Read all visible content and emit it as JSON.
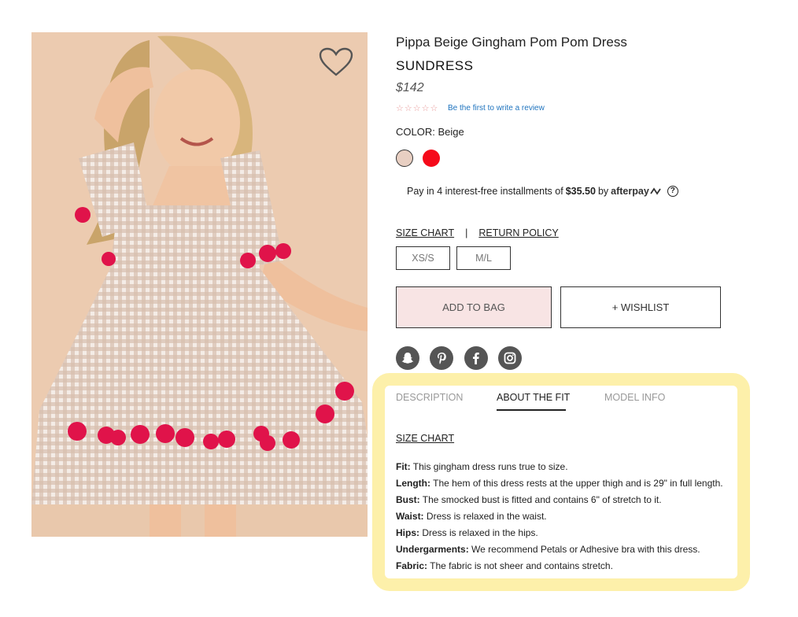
{
  "product": {
    "title": "Pippa Beige Gingham Pom Pom Dress",
    "subtitle": "SUNDRESS",
    "price": "$142",
    "stars": "☆☆☆☆☆",
    "review_link": "Be the first to write a review",
    "color_label": "COLOR: Beige",
    "swatches": [
      {
        "name": "Beige",
        "color": "#e8cfc2",
        "selected": true
      },
      {
        "name": "Red",
        "color": "#f50a1a",
        "selected": false
      }
    ]
  },
  "afterpay": {
    "prefix": "Pay in 4 interest-free installments of",
    "amount": "$35.50",
    "by": "by",
    "brand": "afterpay",
    "help": "?"
  },
  "links": {
    "size_chart": "SIZE CHART",
    "separator": "|",
    "return_policy": "RETURN POLICY"
  },
  "sizes": [
    "XS/S",
    "M/L"
  ],
  "buttons": {
    "add_to_bag": "ADD TO BAG",
    "wishlist": "+ WISHLIST"
  },
  "social_icons": [
    "snapchat-icon",
    "pinterest-icon",
    "facebook-icon",
    "instagram-icon"
  ],
  "tabs": [
    {
      "label": "DESCRIPTION",
      "active": false
    },
    {
      "label": "ABOUT THE FIT",
      "active": true
    },
    {
      "label": "MODEL INFO",
      "active": false
    }
  ],
  "fit": {
    "size_chart_link": "SIZE CHART",
    "details": [
      {
        "label": "Fit:",
        "text": "This gingham dress runs true to size."
      },
      {
        "label": "Length:",
        "text": "The hem of this dress rests at the upper thigh and is 29\" in full length."
      },
      {
        "label": "Bust:",
        "text": "The smocked bust is fitted and contains 6\" of stretch to it."
      },
      {
        "label": "Waist:",
        "text": "Dress is relaxed in the waist."
      },
      {
        "label": "Hips:",
        "text": "Dress is relaxed in the hips."
      },
      {
        "label": "Undergarments:",
        "text": "We recommend Petals or Adhesive bra with this dress."
      },
      {
        "label": "Fabric:",
        "text": "The fabric is not sheer and contains stretch."
      }
    ]
  },
  "colors": {
    "highlight": "#fdf0aa",
    "add_to_bag_bg": "#f8e4e4",
    "pom_pom": "#e0134a",
    "review_link": "#1e73be"
  }
}
